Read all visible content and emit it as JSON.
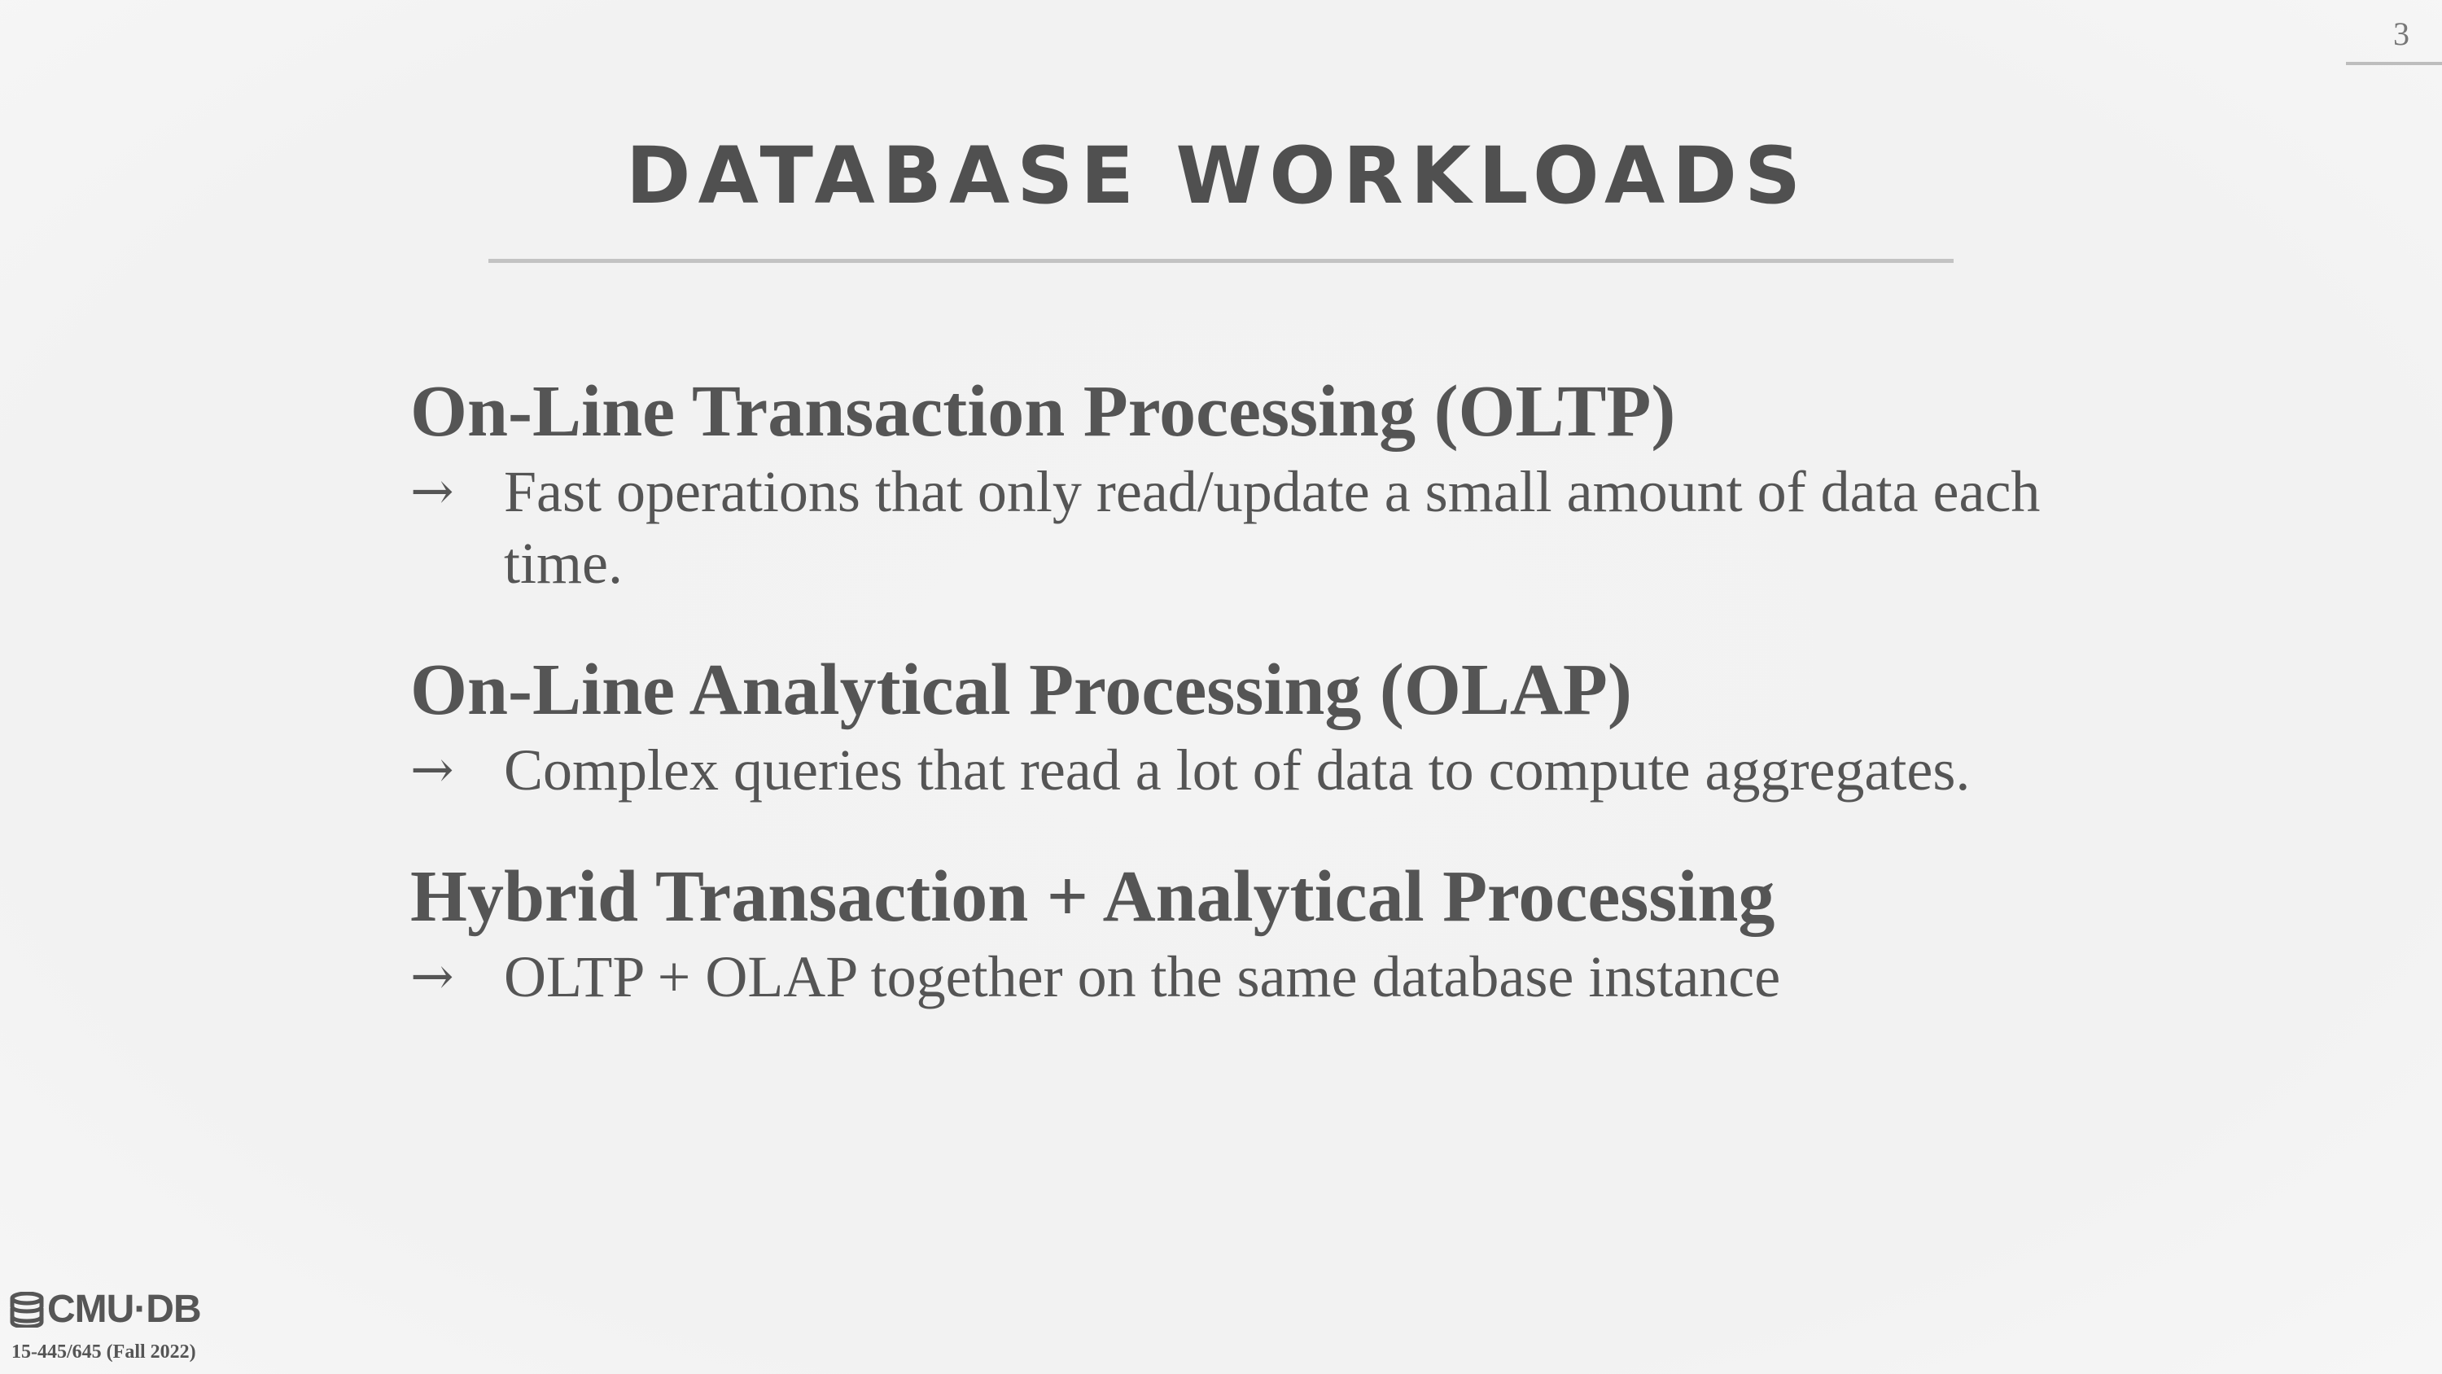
{
  "page_number": "3",
  "title": "DATABASE WORKLOADS",
  "sections": [
    {
      "heading": "On-Line Transaction Processing (OLTP)",
      "arrow": "→",
      "bullet": "Fast operations that only read/update a small amount of data each time."
    },
    {
      "heading": "On-Line Analytical Processing (OLAP)",
      "arrow": "→",
      "bullet": "Complex queries that read a lot of data to compute aggregates."
    },
    {
      "heading": "Hybrid Transaction + Analytical Processing",
      "arrow": "→",
      "bullet": "OLTP + OLAP together on the same database instance"
    }
  ],
  "footer": {
    "logo_icon": "database-icon",
    "logo_text": "CMU·DB",
    "course": "15-445/645 (Fall 2022)"
  },
  "colors": {
    "background": "#f2f2f2",
    "text": "#555555",
    "rule": "#c3c3c3"
  }
}
